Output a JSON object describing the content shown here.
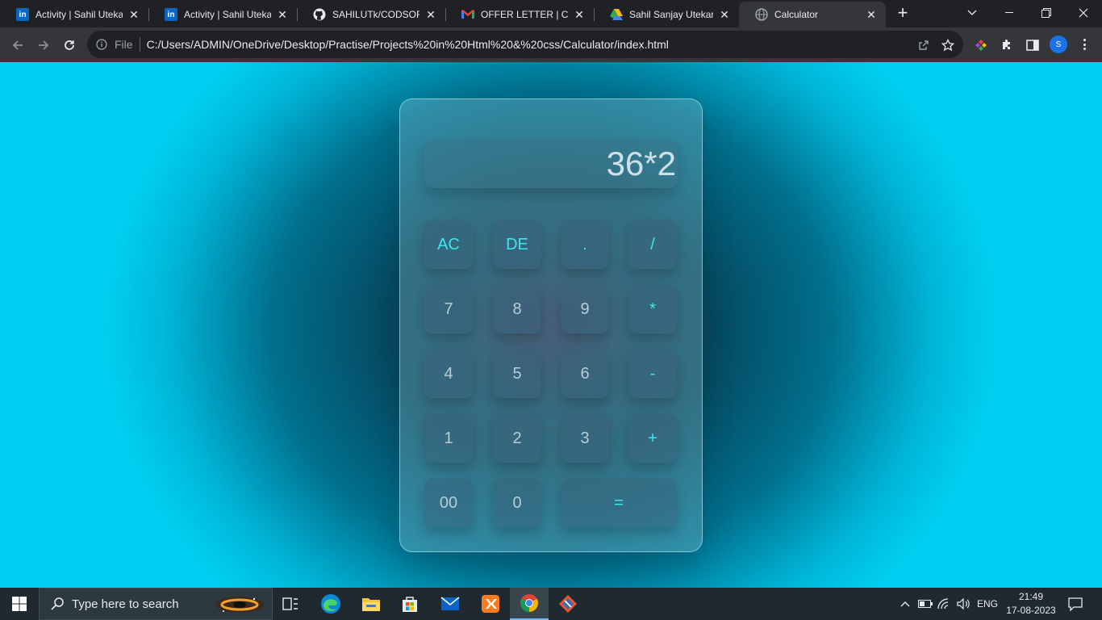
{
  "browser": {
    "tabs": [
      {
        "title": "Activity | Sahil Utekar |",
        "icon": "linkedin-icon",
        "active": false
      },
      {
        "title": "Activity | Sahil Utekar |",
        "icon": "linkedin-icon",
        "active": false
      },
      {
        "title": "SAHILUTk/CODSOFT:",
        "icon": "github-icon",
        "active": false
      },
      {
        "title": "OFFER LETTER | CODS",
        "icon": "gmail-icon",
        "active": false
      },
      {
        "title": "Sahil Sanjay Utekar.pd",
        "icon": "google-drive-icon",
        "active": false
      },
      {
        "title": "Calculator",
        "icon": "globe-icon",
        "active": true
      }
    ],
    "address": {
      "scheme_label": "File",
      "url": "C:/Users/ADMIN/OneDrive/Desktop/Practise/Projects%20in%20Html%20&%20css/Calculator/index.html"
    },
    "profile_initial": "S"
  },
  "calculator": {
    "display": "36*2",
    "keys": [
      {
        "label": "AC",
        "name": "all-clear",
        "type": "op"
      },
      {
        "label": "DE",
        "name": "delete",
        "type": "op"
      },
      {
        "label": ".",
        "name": "decimal",
        "type": "op"
      },
      {
        "label": "/",
        "name": "divide",
        "type": "op"
      },
      {
        "label": "7",
        "name": "7",
        "type": "num"
      },
      {
        "label": "8",
        "name": "8",
        "type": "num"
      },
      {
        "label": "9",
        "name": "9",
        "type": "num"
      },
      {
        "label": "*",
        "name": "multiply",
        "type": "op"
      },
      {
        "label": "4",
        "name": "4",
        "type": "num"
      },
      {
        "label": "5",
        "name": "5",
        "type": "num"
      },
      {
        "label": "6",
        "name": "6",
        "type": "num"
      },
      {
        "label": "-",
        "name": "subtract",
        "type": "op"
      },
      {
        "label": "1",
        "name": "1",
        "type": "num"
      },
      {
        "label": "2",
        "name": "2",
        "type": "num"
      },
      {
        "label": "3",
        "name": "3",
        "type": "num"
      },
      {
        "label": "+",
        "name": "add",
        "type": "op"
      },
      {
        "label": "00",
        "name": "double-zero",
        "type": "num"
      },
      {
        "label": "0",
        "name": "0",
        "type": "num"
      },
      {
        "label": "=",
        "name": "equals",
        "type": "op"
      }
    ]
  },
  "taskbar": {
    "search_placeholder": "Type here to search",
    "apps": [
      "task-view-icon",
      "edge-icon",
      "file-explorer-icon",
      "store-icon",
      "mail-icon",
      "xampp-icon",
      "chrome-icon",
      "git-icon"
    ],
    "language": "ENG",
    "time": "21:49",
    "date": "17-08-2023"
  },
  "colors": {
    "accent_key_text": "#3fe6ee",
    "background_edge": "#00d1f2",
    "background_center": "#163a52"
  }
}
